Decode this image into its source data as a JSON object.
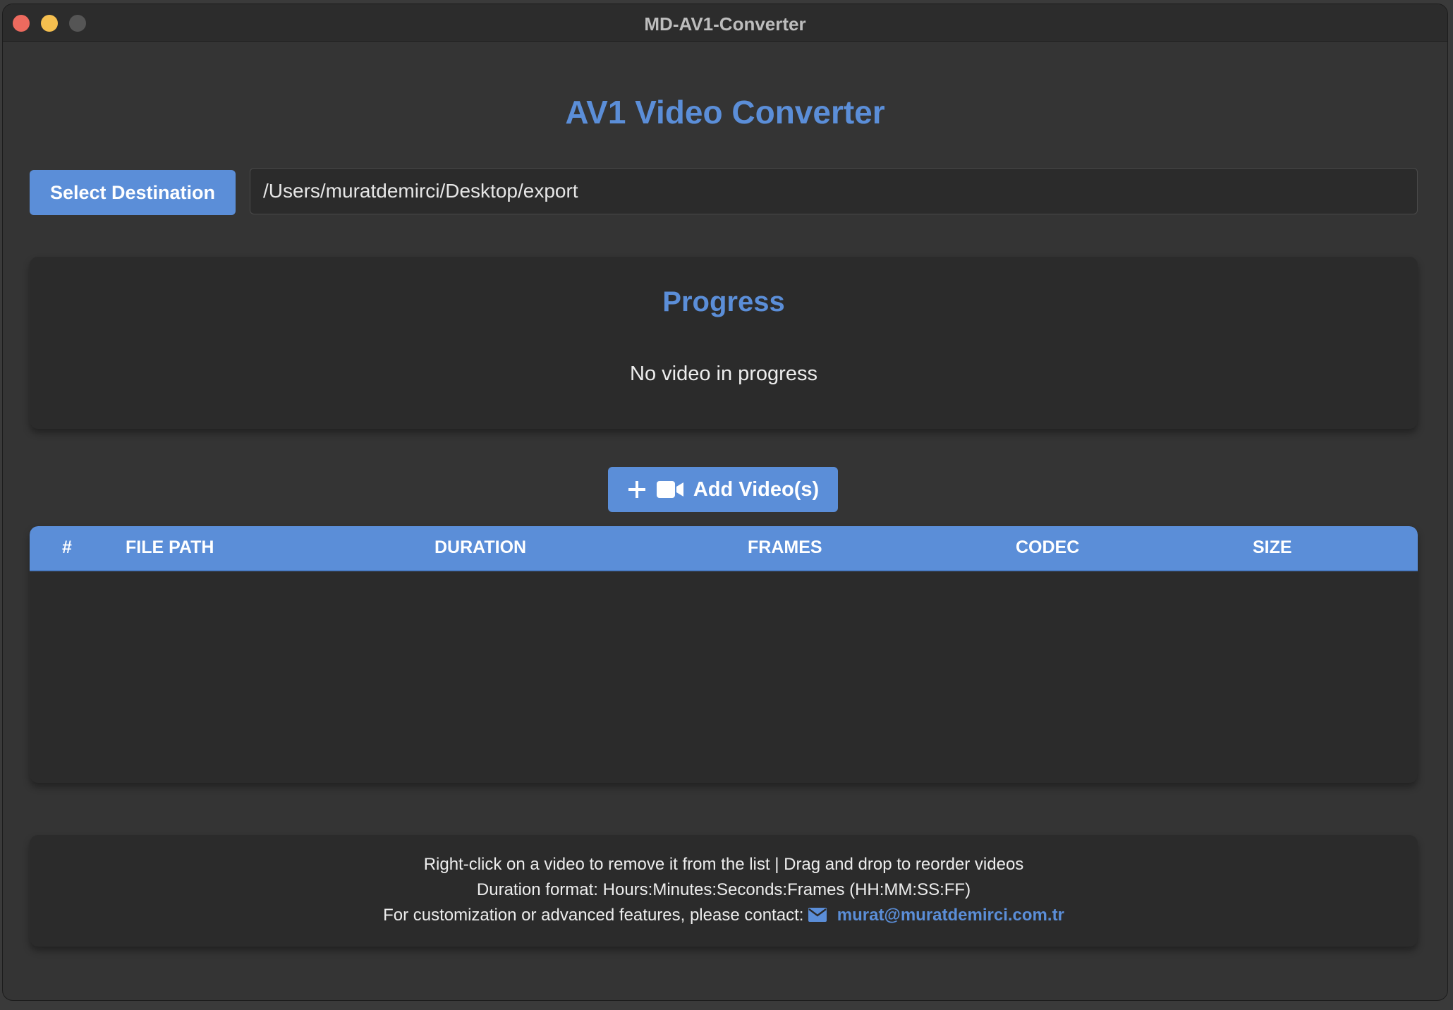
{
  "window": {
    "title": "MD-AV1-Converter"
  },
  "app": {
    "heading": "AV1 Video Converter"
  },
  "destination": {
    "button_label": "Select Destination",
    "path_value": "/Users/muratdemirci/Desktop/export"
  },
  "progress": {
    "title": "Progress",
    "status": "No video in progress"
  },
  "add_videos": {
    "label": "Add Video(s)",
    "icons": [
      "plus-icon",
      "video-camera-icon"
    ]
  },
  "table": {
    "columns": [
      "#",
      "FILE PATH",
      "DURATION",
      "FRAMES",
      "CODEC",
      "SIZE"
    ],
    "rows": []
  },
  "footer": {
    "line1": "Right-click on a video to remove it from the list | Drag and drop to reorder videos",
    "line2": "Duration format: Hours:Minutes:Seconds:Frames (HH:MM:SS:FF)",
    "line3_prefix": "For customization or advanced features, please contact:",
    "contact_email": "murat@muratdemirci.com.tr"
  },
  "colors": {
    "accent": "#5b8ed8",
    "window_bg": "#343434",
    "panel_bg": "#2b2b2b",
    "close": "#ed6a5e",
    "minimize": "#f5bf4f"
  }
}
